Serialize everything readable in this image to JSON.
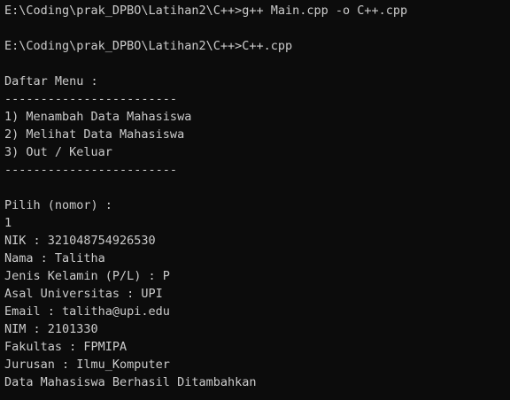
{
  "terminal": {
    "lines": [
      "E:\\Coding\\prak_DPBO\\Latihan2\\C++>g++ Main.cpp -o C++.cpp",
      "",
      "E:\\Coding\\prak_DPBO\\Latihan2\\C++>C++.cpp",
      "",
      "Daftar Menu :",
      "------------------------",
      "1) Menambah Data Mahasiswa",
      "2) Melihat Data Mahasiswa",
      "3) Out / Keluar",
      "------------------------",
      "",
      "Pilih (nomor) :",
      "1",
      "NIK : 321048754926530",
      "Nama : Talitha",
      "Jenis Kelamin (P/L) : P",
      "Asal Universitas : UPI",
      "Email : talitha@upi.edu",
      "NIM : 2101330",
      "Fakultas : FPMIPA",
      "Jurusan : Ilmu_Komputer",
      "Data Mahasiswa Berhasil Ditambahkan"
    ]
  },
  "colors": {
    "background": "#0c0c0c",
    "text": "#cccccc"
  }
}
